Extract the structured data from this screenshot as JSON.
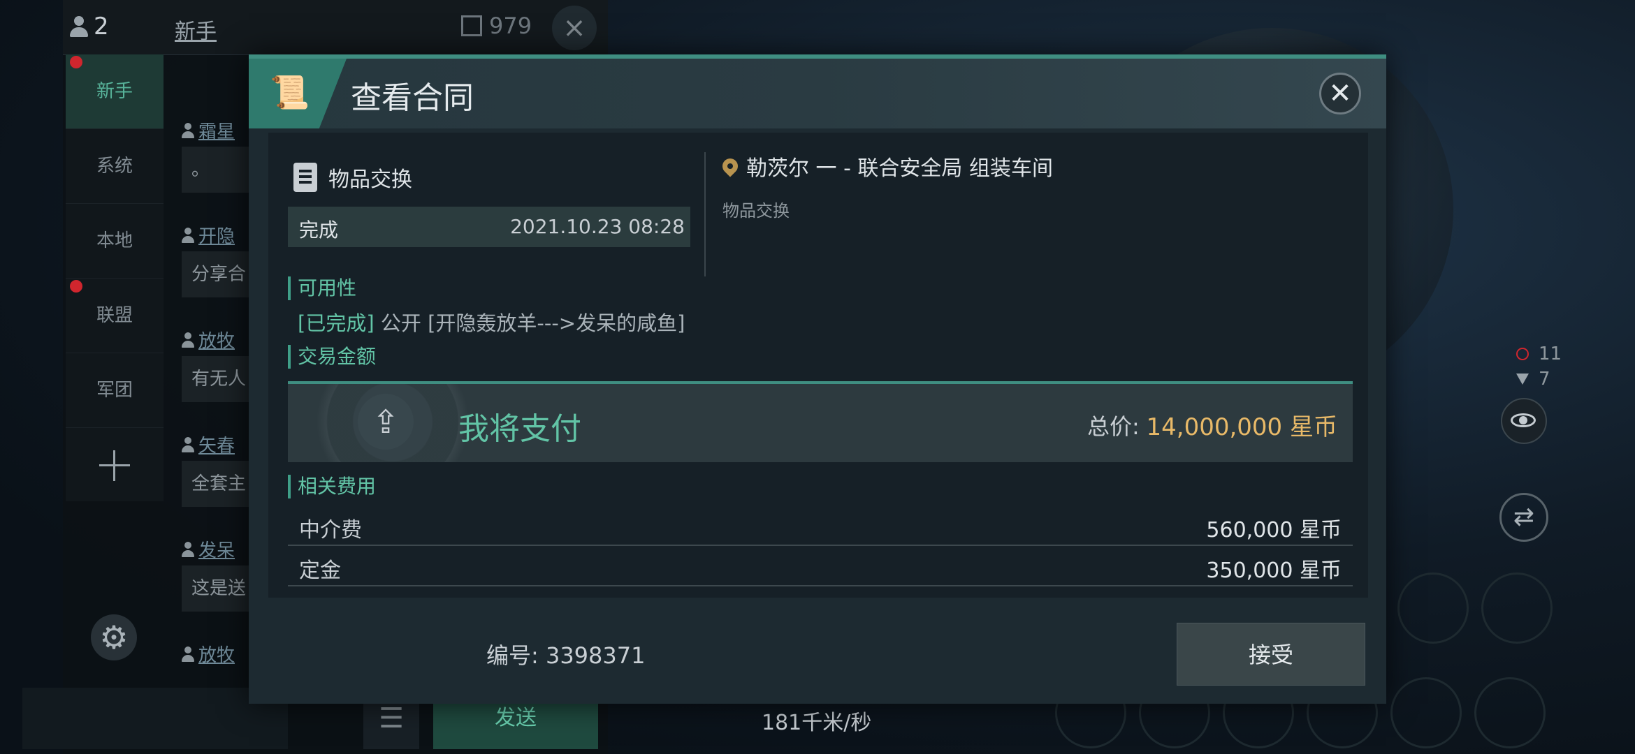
{
  "chat": {
    "online_count": "2",
    "channel_title": "新手",
    "coin_count": "979",
    "tabs": [
      {
        "label": "新手"
      },
      {
        "label": "系统"
      },
      {
        "label": "本地"
      },
      {
        "label": "联盟"
      },
      {
        "label": "军团"
      }
    ],
    "messages": [
      {
        "author": "霜星",
        "text": "。"
      },
      {
        "author": "开隐",
        "text": "分享合"
      },
      {
        "author": "放牧",
        "text": "有无人"
      },
      {
        "author": "矢春",
        "text": "全套主"
      },
      {
        "author": "发呆",
        "text": "这是送"
      },
      {
        "author": "放牧",
        "text": ""
      }
    ],
    "send_label": "发送"
  },
  "hud": {
    "stat_a": "11",
    "stat_b": "7",
    "speed": "181千米/秒"
  },
  "modal": {
    "title": "查看合同",
    "exchange_type": "物品交换",
    "status": "完成",
    "timestamp": "2021.10.23 08:28",
    "location": "勒茨尔 一 - 联合安全局 组装车间",
    "location_desc": "物品交换",
    "availability_label": "可用性",
    "availability_status": "[已完成]",
    "availability_text": "公开 [开隐轰放羊--->发呆的咸鱼]",
    "amount_label": "交易金额",
    "pay_label": "我将支付",
    "total_label": "总价:",
    "total_value": "14,000,000 星币",
    "fees_label": "相关费用",
    "fees": [
      {
        "name": "中介费",
        "value": "560,000 星币"
      },
      {
        "name": "定金",
        "value": "350,000 星币"
      }
    ],
    "contract_id": "编号: 3398371",
    "accept_label": "接受"
  },
  "colors": {
    "accent": "#3f8e81",
    "highlight_text": "#62c4a6",
    "price": "#e8b968"
  }
}
